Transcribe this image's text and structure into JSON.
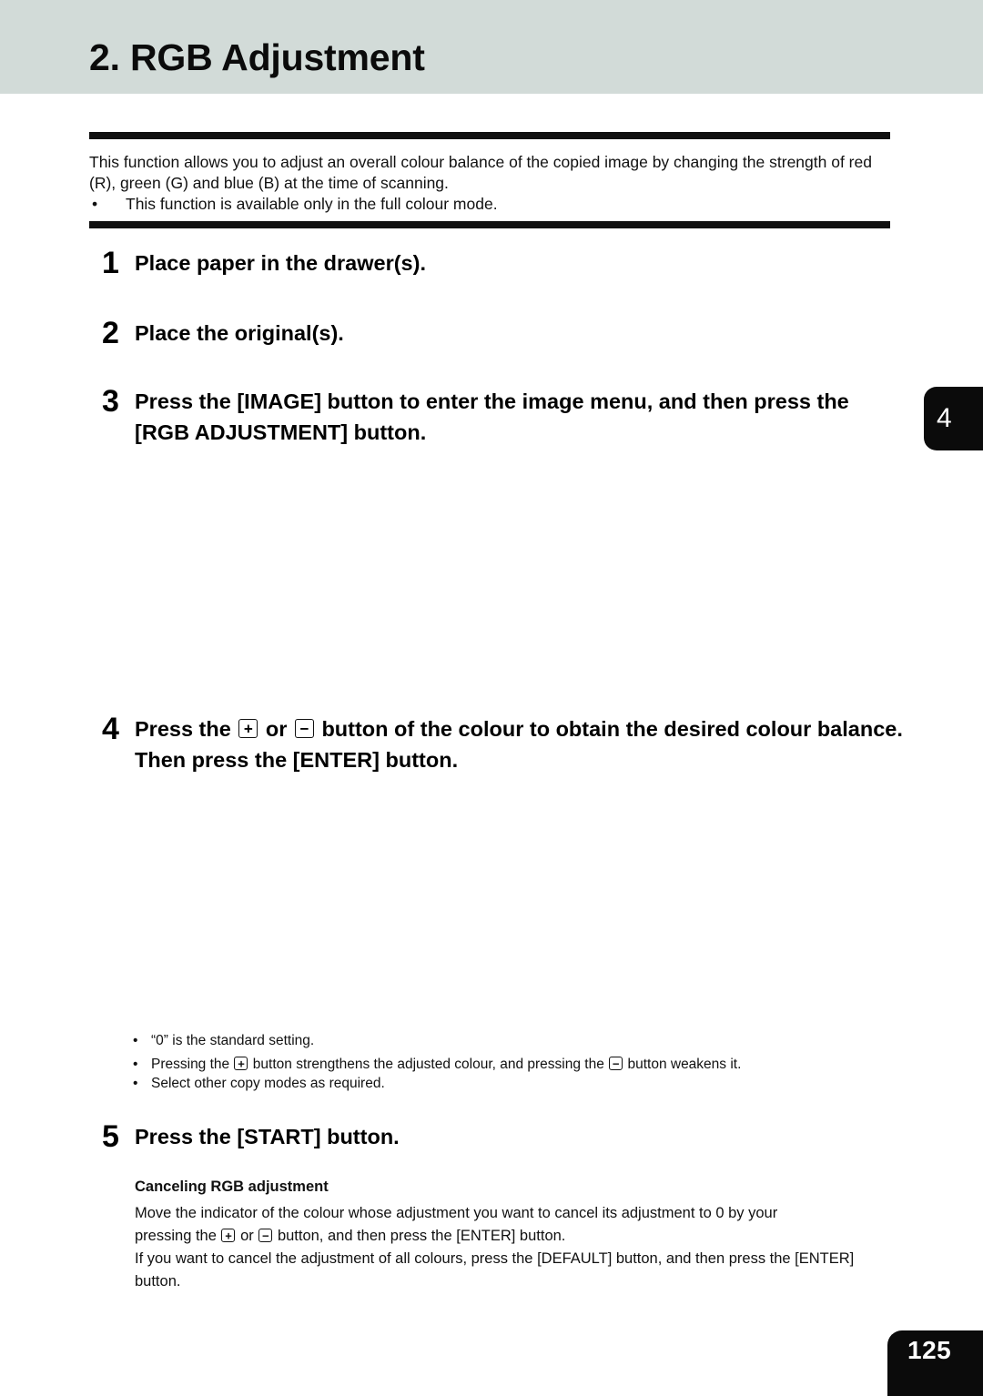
{
  "header": {
    "title": "2. RGB Adjustment",
    "band_color": "#d2dbd8"
  },
  "intro": {
    "paragraph": "This function allows you to adjust an overall colour balance of the copied image by changing the strength of red (R), green (G) and blue (B) at the time of scanning.",
    "bullet_marker": "•",
    "bullet": "This function is available only in the full colour mode."
  },
  "steps": [
    {
      "number": "1",
      "text": "Place paper in the drawer(s)."
    },
    {
      "number": "2",
      "text": "Place the original(s)."
    },
    {
      "number": "3",
      "text": "Press the [IMAGE] button to enter the image menu, and then press the [RGB ADJUSTMENT] button."
    },
    {
      "number": "4",
      "text_part_1": "Press the",
      "key_plus": "+",
      "text_part_2": "or",
      "key_minus": "−",
      "text_part_3": "button of the colour to obtain the desired colour balance. Then press the [ENTER] button."
    },
    {
      "number": "5",
      "text": "Press the [START] button."
    }
  ],
  "notes": {
    "bullet_marker": "•",
    "note_1": "“0” is the standard setting.",
    "note_2_part_1": "Pressing the",
    "note_2_key_plus": "+",
    "note_2_part_2": "button strengthens the adjusted colour, and pressing the",
    "note_2_key_minus": "−",
    "note_2_part_3": "button weakens it.",
    "note_3": "Select other copy modes as required."
  },
  "canceling": {
    "heading": "Canceling RGB adjustment",
    "para_1": "Move the indicator of the colour whose adjustment you want to cancel its adjustment to 0 by your",
    "para_2_part_1": "pressing the",
    "para_2_key_plus": "+",
    "para_2_part_2": "or",
    "para_2_key_minus": "−",
    "para_2_part_3": "button, and then press the [ENTER] button.",
    "para_3": "If you want to cancel the adjustment of all colours, press the [DEFAULT] button, and then press the [ENTER] button."
  },
  "chapter_tab": {
    "label": "4"
  },
  "page_tab": {
    "number": "125"
  }
}
